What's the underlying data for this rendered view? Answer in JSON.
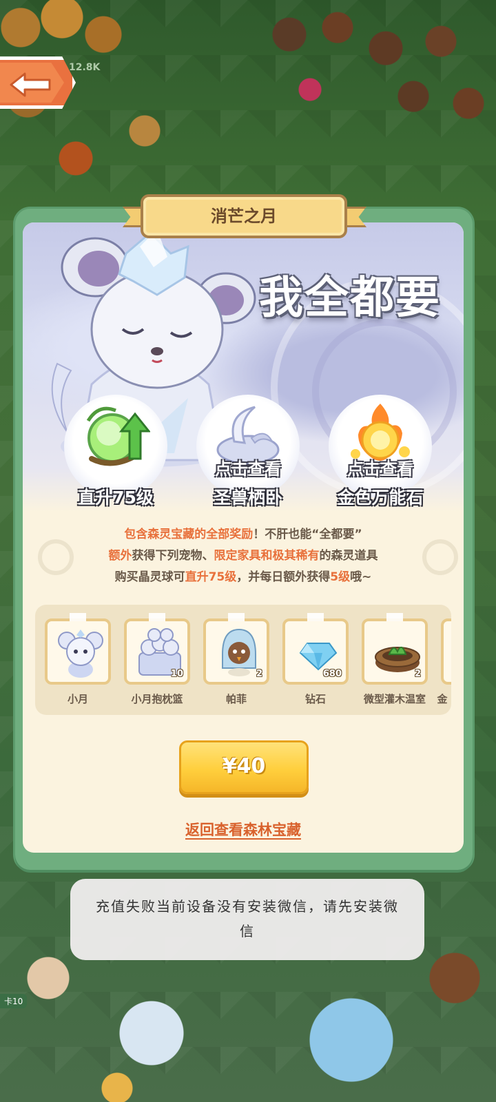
{
  "app": {
    "background_counter": "12.8K",
    "side_tag": "卡10"
  },
  "dialog": {
    "title": "消芒之月",
    "slogan": "我全都要",
    "featured_rewards": [
      {
        "label": "直升75级",
        "icon": "level-up-orb-icon",
        "has_view": false
      },
      {
        "label": "圣兽栖卧",
        "icon": "moon-bed-icon",
        "has_view": true,
        "view_label": "点击查看"
      },
      {
        "label": "金色万能石",
        "icon": "golden-stone-icon",
        "has_view": true,
        "view_label": "点击查看"
      }
    ],
    "description": {
      "line1_a": "包含森灵宝藏的全部奖励",
      "line1_b": "！不肝也能“全都要”",
      "line2_a": "额外",
      "line2_b": "获得下列宠物、",
      "line2_c": "限定家具和极其稀有",
      "line2_d": "的森灵道具",
      "line3_a": "购买晶灵球可",
      "line3_b": "直升75级",
      "line3_c": "，并每日额外获得",
      "line3_d": "5级",
      "line3_e": "哦~"
    },
    "items": [
      {
        "name": "小月",
        "qty": "",
        "icon": "xiaoyue-pet-icon"
      },
      {
        "name": "小月抱枕篮",
        "qty": "10",
        "icon": "pillow-basket-icon"
      },
      {
        "name": "帕菲",
        "qty": "2",
        "icon": "pafei-pet-icon"
      },
      {
        "name": "钻石",
        "qty": "680",
        "icon": "diamond-icon"
      },
      {
        "name": "微型灌木温室",
        "qty": "2",
        "icon": "shrub-greenhouse-icon"
      },
      {
        "name": "金",
        "qty": "",
        "icon": "gold-item-icon"
      }
    ],
    "buy_button": "¥40",
    "return_link": "返回查看森林宝藏"
  },
  "toast": {
    "message": "充值失败当前设备没有安装微信，请先安装微信"
  },
  "colors": {
    "accent": "#e8713c",
    "frame_green": "#6fae7f",
    "button_yellow": "#ffcf3d",
    "panel_cream": "#fbf3df"
  }
}
